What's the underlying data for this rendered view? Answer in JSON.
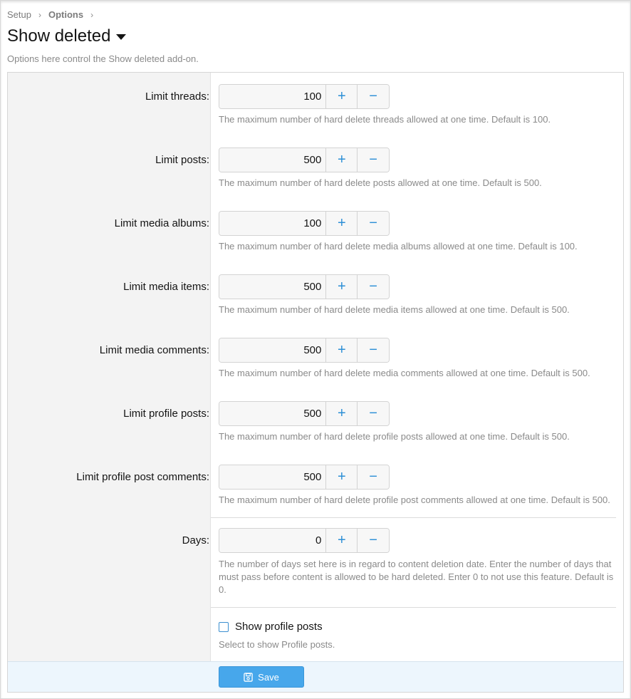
{
  "breadcrumb": {
    "items": [
      "Setup",
      "Options"
    ],
    "separator": "›"
  },
  "header": {
    "title": "Show deleted",
    "description": "Options here control the Show deleted add-on."
  },
  "stepper": {
    "plus": "+",
    "minus": "−"
  },
  "options": [
    {
      "label": "Limit threads:",
      "value": "100",
      "hint": "The maximum number of hard delete threads allowed at one time. Default is 100."
    },
    {
      "label": "Limit posts:",
      "value": "500",
      "hint": "The maximum number of hard delete posts allowed at one time. Default is 500."
    },
    {
      "label": "Limit media albums:",
      "value": "100",
      "hint": "The maximum number of hard delete media albums allowed at one time. Default is 100."
    },
    {
      "label": "Limit media items:",
      "value": "500",
      "hint": "The maximum number of hard delete media items allowed at one time. Default is 500."
    },
    {
      "label": "Limit media comments:",
      "value": "500",
      "hint": "The maximum number of hard delete media comments allowed at one time. Default is 500."
    },
    {
      "label": "Limit profile posts:",
      "value": "500",
      "hint": "The maximum number of hard delete profile posts allowed at one time. Default is 500."
    },
    {
      "label": "Limit profile post comments:",
      "value": "500",
      "hint": "The maximum number of hard delete profile post comments allowed at one time. Default is 500."
    },
    {
      "label": "Days:",
      "value": "0",
      "hint": "The number of days set here is in regard to content deletion date. Enter the number of days that must pass before content is allowed to be hard deleted. Enter 0 to not use this feature. Default is 0."
    }
  ],
  "checkbox": {
    "label": "Show profile posts",
    "hint": "Select to show Profile posts.",
    "checked": false
  },
  "footer": {
    "save_label": "Save"
  },
  "colors": {
    "accent": "#2c8fd6",
    "save_button": "#47a7eb"
  }
}
